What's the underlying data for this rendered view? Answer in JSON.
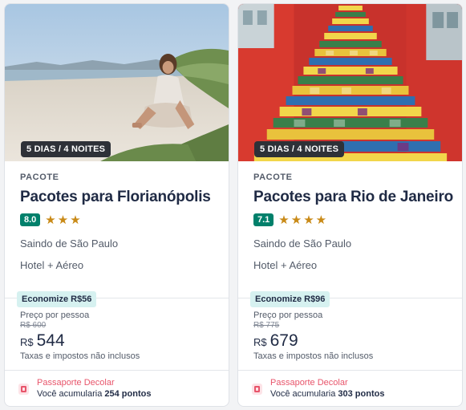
{
  "cards": [
    {
      "duration": "5 DIAS / 4 NOITES",
      "kind": "PACOTE",
      "title": "Pacotes para Florianópolis",
      "score": "8.0",
      "stars": 3,
      "origin": "Saindo de São Paulo",
      "product": "Hotel + Aéreo",
      "savings": "Economize R$56",
      "per_person": "Preço por pessoa",
      "old_price": "R$ 600",
      "currency": "R$",
      "price": "544",
      "taxes": "Taxas e impostos não inclusos",
      "passport_label": "Passaporte Decolar",
      "points_prefix": "Você acumularia",
      "points_value": "254 pontos"
    },
    {
      "duration": "5 DIAS / 4 NOITES",
      "kind": "PACOTE",
      "title": "Pacotes para Rio de Janeiro",
      "score": "7.1",
      "stars": 4,
      "origin": "Saindo de São Paulo",
      "product": "Hotel + Aéreo",
      "savings": "Economize R$96",
      "per_person": "Preço por pessoa",
      "old_price": "R$ 775",
      "currency": "R$",
      "price": "679",
      "taxes": "Taxas e impostos não inclusos",
      "passport_label": "Passaporte Decolar",
      "points_prefix": "Você acumularia",
      "points_value": "303 pontos"
    }
  ],
  "colors": {
    "accent_teal": "#00806b",
    "star": "#c98a17",
    "passport": "#e8556b",
    "savings_bg": "#d6f1f0"
  },
  "icons": {
    "star": "star-icon",
    "passport": "passport-icon"
  }
}
